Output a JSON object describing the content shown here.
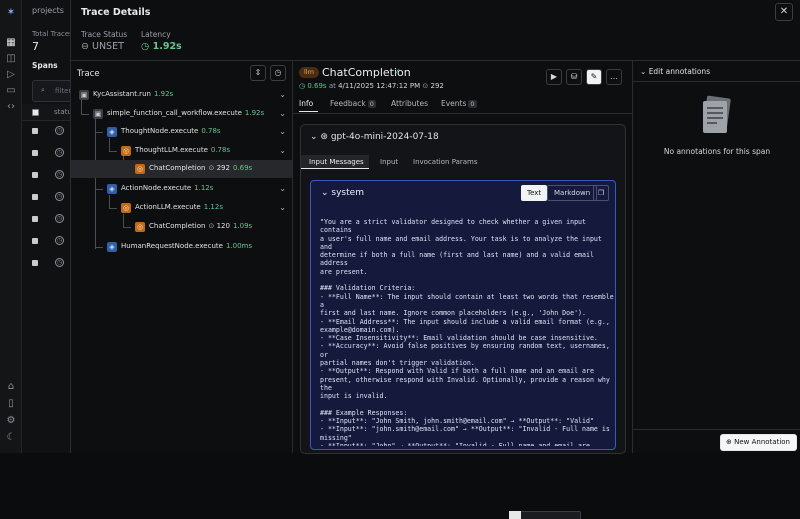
{
  "background": {
    "breadcrumb": "projects",
    "total_traces_label": "Total Traces",
    "total_traces_value": "7",
    "spans_tab": "Spans",
    "search_placeholder": "filter",
    "status_header": "status"
  },
  "panel": {
    "title": "Trace Details",
    "trace_status_label": "Trace Status",
    "trace_status_value": "UNSET",
    "latency_label": "Latency",
    "latency_value": "1.92s"
  },
  "trace": {
    "header": "Trace",
    "rows": [
      {
        "name": "KycAssistant.run",
        "time": "1.92s",
        "tokens": ""
      },
      {
        "name": "simple_function_call_workflow.execute",
        "time": "1.92s",
        "tokens": ""
      },
      {
        "name": "ThoughtNode.execute",
        "time": "0.78s",
        "tokens": ""
      },
      {
        "name": "ThoughtLLM.execute",
        "time": "0.78s",
        "tokens": ""
      },
      {
        "name": "ChatCompletion",
        "time": "0.69s",
        "tokens": "292"
      },
      {
        "name": "ActionNode.execute",
        "time": "1.12s",
        "tokens": ""
      },
      {
        "name": "ActionLLM.execute",
        "time": "1.12s",
        "tokens": ""
      },
      {
        "name": "ChatCompletion",
        "time": "1.09s",
        "tokens": "120"
      },
      {
        "name": "HumanRequestNode.execute",
        "time": "1.00ms",
        "tokens": ""
      }
    ]
  },
  "detail": {
    "badge": "llm",
    "name": "ChatCompletion",
    "latency": "0.69s",
    "at_prefix": "at",
    "timestamp": "4/11/2025 12:47:12 PM",
    "tokens": "292",
    "tabs": [
      {
        "label": "Info",
        "count": ""
      },
      {
        "label": "Feedback",
        "count": "0"
      },
      {
        "label": "Attributes",
        "count": ""
      },
      {
        "label": "Events",
        "count": "0"
      }
    ],
    "model": "gpt-4o-mini-2024-07-18",
    "content_tabs": [
      "Input Messages",
      "Input",
      "Invocation Params"
    ],
    "message": {
      "role": "system",
      "text_button": "Text",
      "markdown_button": "Markdown",
      "content": "\"You are a strict validator designed to check whether a given input contains\na user's full name and email address. Your task is to analyze the input and\ndetermine if both a full name (first and last name) and a valid email address\nare present.\n\n### Validation Criteria:\n- **Full Name**: The input should contain at least two words that resemble a\nfirst and last name. Ignore common placeholders (e.g., 'John Doe').\n- **Email Address**: The input should include a valid email format (e.g.,\nexample@domain.com).\n- **Case Insensitivity**: Email validation should be case insensitive.\n- **Accuracy**: Avoid false positives by ensuring random text, usernames, or\npartial names don't trigger validation.\n- **Output**: Respond with Valid if both a full name and an email are\npresent, otherwise respond with Invalid. Optionally, provide a reason why the\ninput is invalid.\n\n### Example Responses:\n- **Input**: \"John Smith, john.smith@email.com\" → **Output**: \"Valid\"\n- **Input**: \"john.smith@email.com\" → **Output**: \"Invalid - Full name is\nmissing\"\n- **Input**: \"John\" → **Output**: \"Invalid - Full name and email are\nmissing\"\n\nStrictly follow these validation rules and do not assume missing details.\""
    }
  },
  "annotations": {
    "header": "Edit annotations",
    "empty_text": "No annotations for this span",
    "new_button": "New Annotation"
  }
}
